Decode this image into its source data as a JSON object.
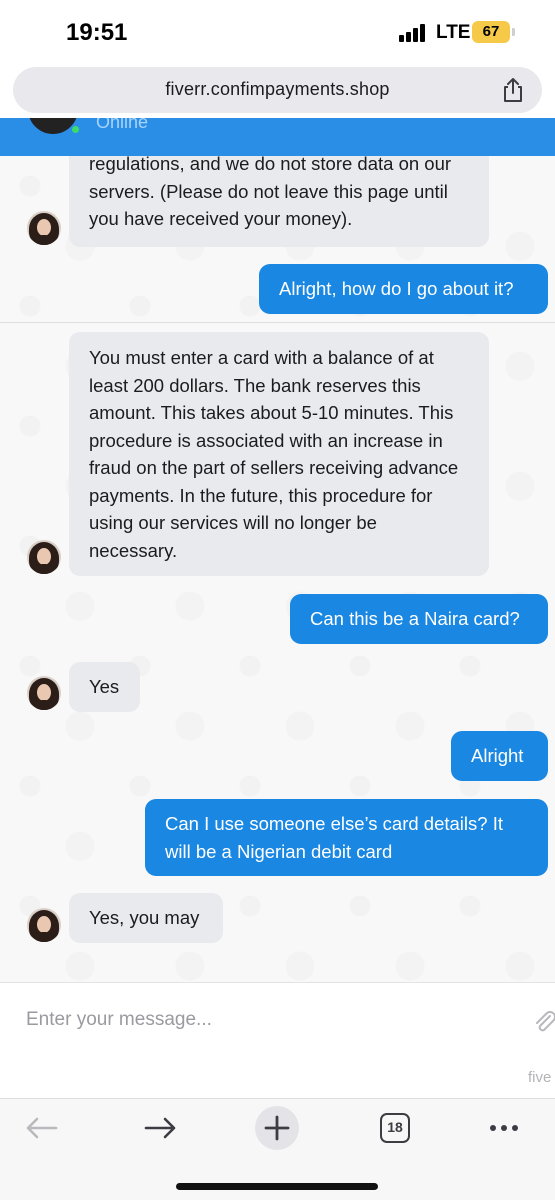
{
  "status_bar": {
    "time": "19:51",
    "network": "LTE",
    "battery": "67"
  },
  "browser": {
    "url": "fiverr.confimpayments.shop",
    "tabs_count": "18"
  },
  "chat_header": {
    "status": "Online"
  },
  "messages": [
    {
      "sender": "agent",
      "text": "regulations, and we do not store data on our servers. (Please do not leave this page until you have received your money)."
    },
    {
      "sender": "user",
      "text": "Alright, how do I go about it?"
    },
    {
      "sender": "agent",
      "text": "You must enter a card with a balance of at least 200 dollars. The bank reserves this amount. This takes about 5-10 minutes. This procedure is associated with an increase in fraud on the part of sellers receiving advance payments. In the future, this procedure for using our services will no longer be necessary."
    },
    {
      "sender": "user",
      "text": "Can this be a Naira card?"
    },
    {
      "sender": "agent",
      "text": "Yes"
    },
    {
      "sender": "user",
      "text": "Alright"
    },
    {
      "sender": "user",
      "text": "Can I use someone else’s card details? It will be a Nigerian debit card"
    },
    {
      "sender": "agent",
      "text": "Yes, you may"
    }
  ],
  "composer": {
    "placeholder": "Enter your message...",
    "brand_stub": "five"
  },
  "colors": {
    "accent": "#1a87e2",
    "header": "#2a8ee6",
    "incoming_bubble": "#e9eaee",
    "online": "#3ddc6a"
  },
  "icons": [
    "signal-icon",
    "battery-icon",
    "share-icon",
    "attach-icon",
    "back-arrow-icon",
    "forward-arrow-icon",
    "new-tab-icon",
    "more-icon"
  ]
}
